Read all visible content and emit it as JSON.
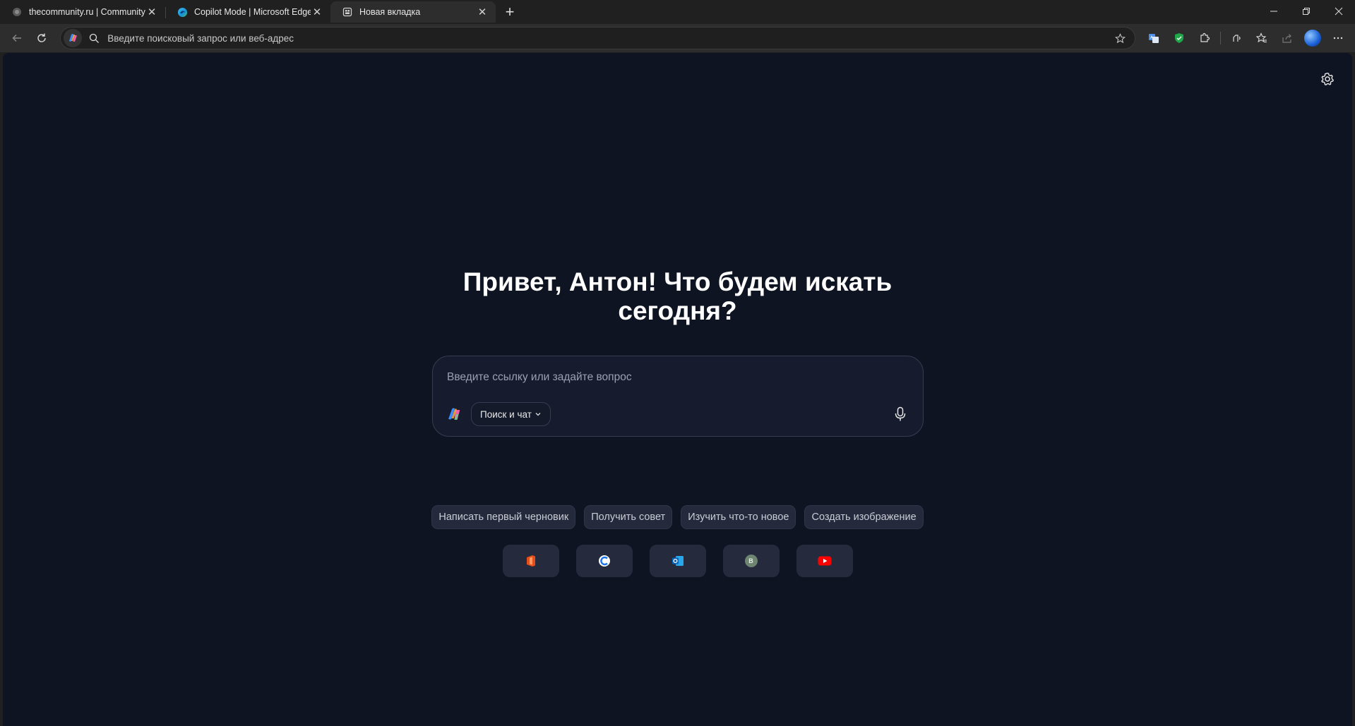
{
  "tabs": [
    {
      "title": "thecommunity.ru | Community",
      "icon": "globe-icon",
      "active": false
    },
    {
      "title": "Copilot Mode | Microsoft Edge",
      "icon": "edge-icon",
      "active": false
    },
    {
      "title": "Новая вкладка",
      "icon": "newtab-page-icon",
      "active": true
    }
  ],
  "address_bar": {
    "placeholder": "Введите поисковый запрос или веб-адрес",
    "value": ""
  },
  "page": {
    "greeting_line1": "Привет, Антон! Что будем искать",
    "greeting_line2": "сегодня?",
    "ask_placeholder": "Введите ссылку или задайте вопрос",
    "mode_label": "Поиск и чат",
    "suggestions": [
      "Написать первый черновик",
      "Получить совет",
      "Изучить что-то новое",
      "Создать изображение"
    ],
    "quick_links": [
      {
        "icon": "office-icon"
      },
      {
        "icon": "c-logo-icon"
      },
      {
        "icon": "outlook-icon"
      },
      {
        "icon": "letter-b-icon",
        "letter": "В"
      },
      {
        "icon": "youtube-icon"
      }
    ]
  },
  "colors": {
    "page_bg": "#0f1423",
    "chrome_bg": "#202020",
    "toolbar_bg": "#2d2d2d",
    "chip_bg": "#242a3b"
  }
}
